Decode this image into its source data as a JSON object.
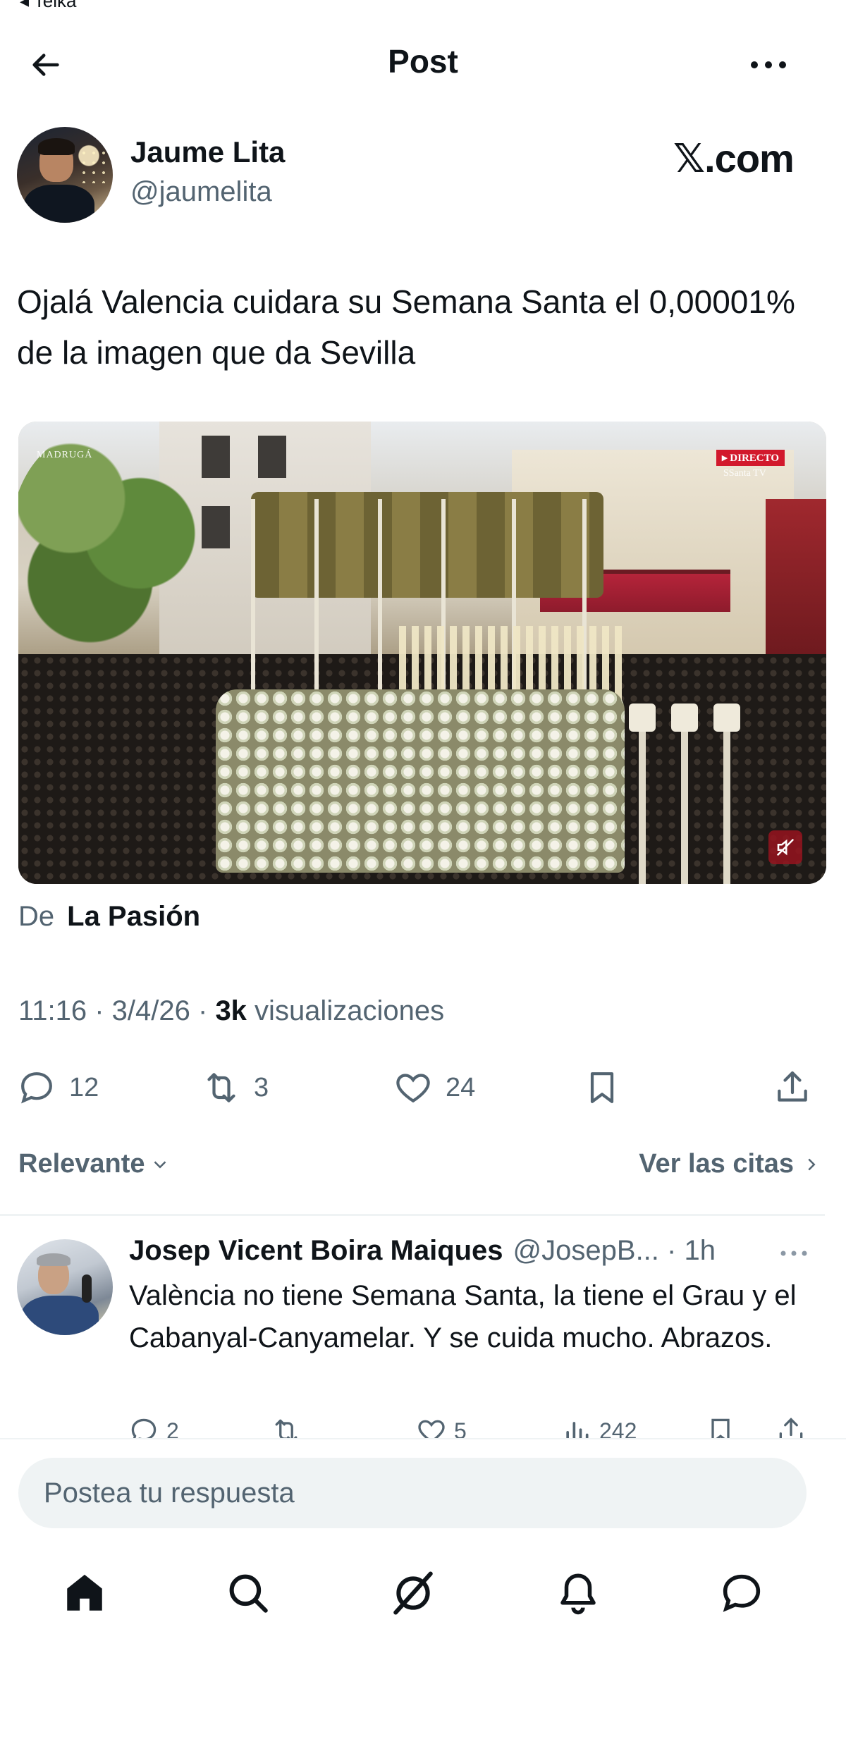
{
  "status": {
    "back_app": "◂ Telka"
  },
  "header": {
    "title": "Post"
  },
  "post": {
    "author_name": "Jaume Lita",
    "author_handle": "@jaumelita",
    "brand": "𝕏.com",
    "text": "Ojalá Valencia cuidara su Semana Santa el 0,00001% de la imagen que da Sevilla",
    "media": {
      "watermark": "MADRUGÁ",
      "live_badge": "▸ DIRECTO",
      "channel": "SSanta TV"
    },
    "source_prefix": "De",
    "source_name": "La Pasión",
    "timestamp": "11:16 · 3/4/26 · ",
    "views_count": "3k",
    "views_label": " visualizaciones",
    "actions": {
      "replies": "12",
      "reposts": "3",
      "likes": "24"
    }
  },
  "sort": {
    "label": "Relevante",
    "quotes_label": "Ver las citas"
  },
  "reply": {
    "name": "Josep Vicent Boira Maiques",
    "handle": "@JosepB... · 1h",
    "text": "València no tiene Semana Santa, la tiene el Grau y el Cabanyal-Canyamelar. Y se cuida mucho. Abrazos.",
    "actions": {
      "replies": "2",
      "likes": "5",
      "views": "242"
    }
  },
  "composer": {
    "placeholder": "Postea tu respuesta"
  },
  "colors": {
    "text": "#0f1419",
    "secondary": "#536471",
    "composer_bg": "#eff3f4"
  }
}
